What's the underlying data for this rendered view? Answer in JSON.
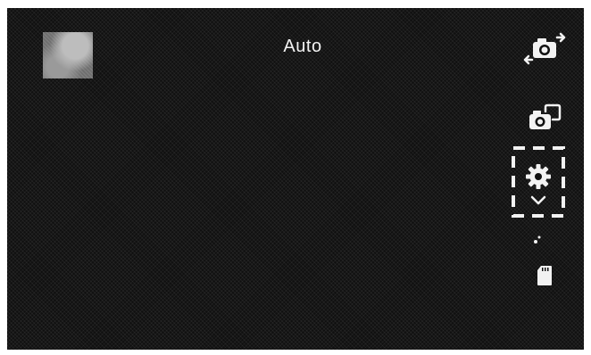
{
  "camera": {
    "mode_label": "Auto"
  },
  "icons": {
    "gallery_thumbnail": "gallery-thumbnail",
    "switch_camera": "switch-camera-icon",
    "camera_mode": "camera-mode-icon",
    "settings": "gear-icon",
    "settings_expand": "chevron-down-icon",
    "night_mode": "night-mode-icon",
    "storage": "sd-card-icon"
  },
  "colors": {
    "background": "#101010",
    "foreground": "#f2f2f2"
  }
}
